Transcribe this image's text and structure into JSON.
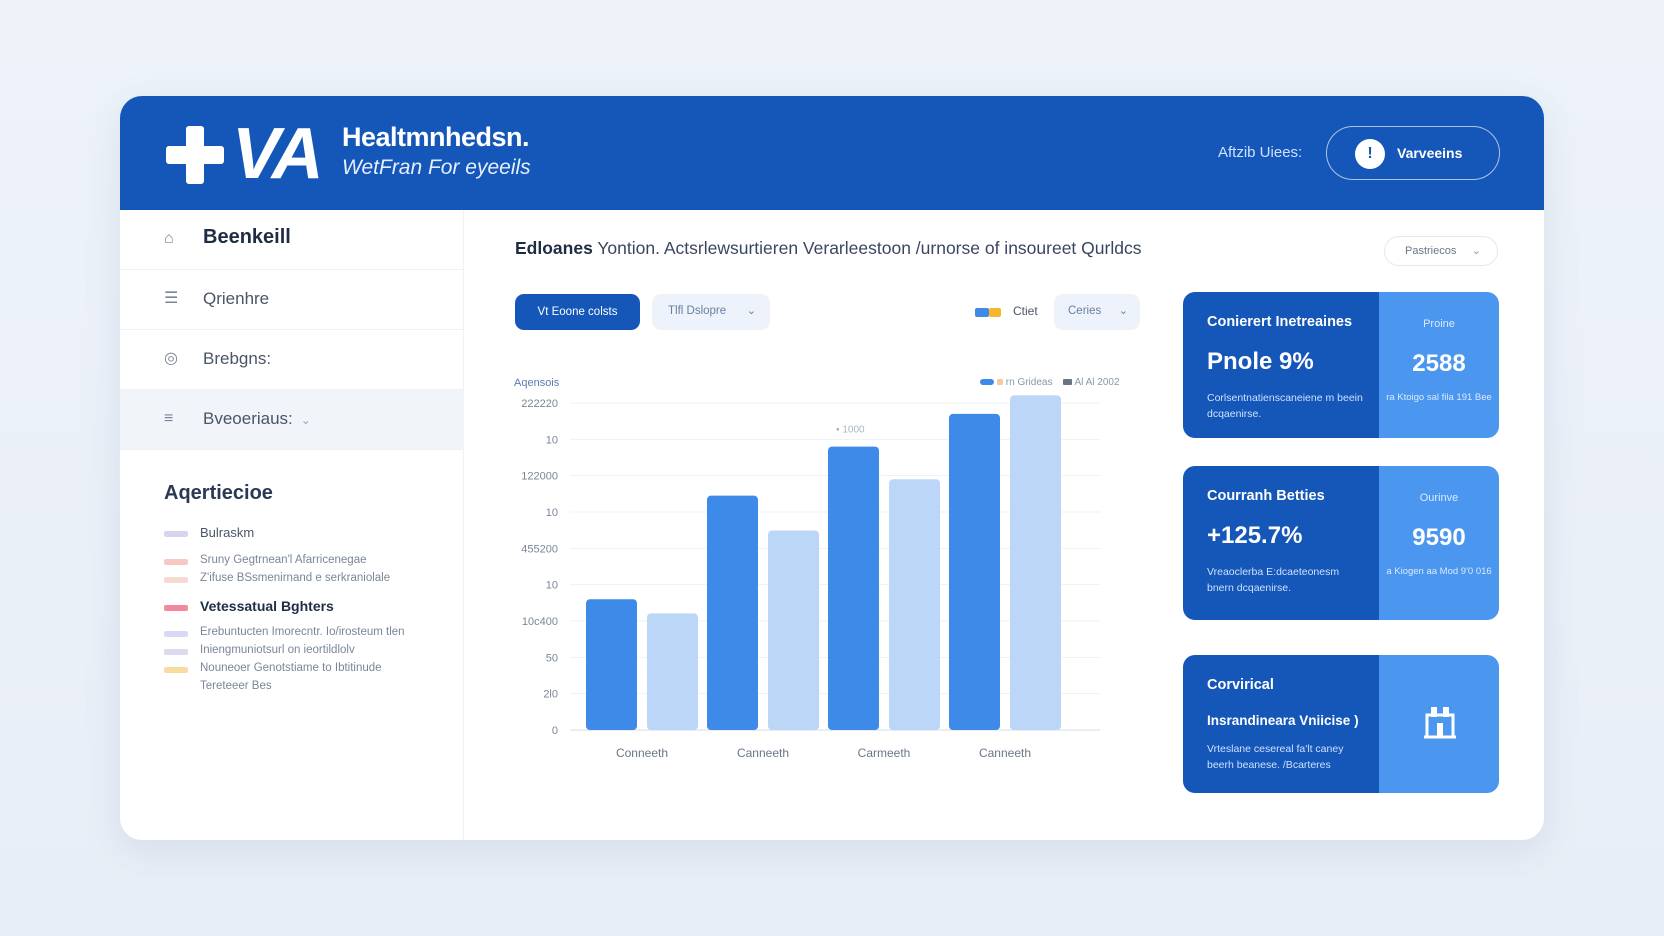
{
  "header": {
    "logo_text": "VA",
    "brand_line1": "Healtmnhedsn.",
    "brand_line2": "WetFran For eyeeils",
    "user_label": "Aftzib Uiees:",
    "user_button": "Varveeins",
    "user_icon": "user-icon"
  },
  "sidebar": {
    "items": [
      {
        "label": "Beenkeill",
        "icon": "home-icon"
      },
      {
        "label": "Qrienhre",
        "icon": "stack-icon"
      },
      {
        "label": "Brebgns:",
        "icon": "gauge-icon"
      },
      {
        "label": "Bveoeriaus:",
        "icon": "list-icon"
      }
    ],
    "section_title": "Aqertiecioe",
    "legend": [
      {
        "label": "Bulraskm",
        "color": "#d9d4ee",
        "style": "med"
      },
      {
        "label": "Sruny Gegtrnean'l Afarricenegae",
        "color": "#f6c9c2",
        "style": "small"
      },
      {
        "label": "Z'ifuse BSsmenirnand e serkraniolale",
        "color": "#f7d9d4",
        "style": "small"
      },
      {
        "label": "Vetessatual Bghters",
        "color": "#f08a9a",
        "style": "big"
      },
      {
        "label": "Erebuntucten Imorecntr. Io/irosteum tlen",
        "color": "#d6dbf3",
        "style": "small"
      },
      {
        "label": "Iniengmuniotsurl on ieortildlolv",
        "color": "#dcd9ef",
        "style": "small"
      },
      {
        "label": "Nouneoer Genotstiame to Ibtitinude",
        "color": "#f6dca0",
        "style": "small"
      },
      {
        "label": "Tereteeer Bes",
        "color": "",
        "style": "small"
      }
    ]
  },
  "main": {
    "title_bold": "Edloanes",
    "title_rest": " Yontion. Actsrlewsurtieren Verarleestoon /urnorse of insoureet Qurldcs",
    "period_button": "Pastriecos",
    "toolbar": {
      "primary_button": "Vt Eoone colsts",
      "select1": "Tlfl Dslopre",
      "legend_label": "Ctiet",
      "select2": "Ceries"
    },
    "chart_label": "Aqensois",
    "chart_legend": [
      "rn Grideas",
      "Al Al 2002"
    ]
  },
  "chart_data": {
    "type": "bar",
    "categories": [
      "Conneeth",
      "Canneeth",
      "Carmeeth",
      "Canneeth"
    ],
    "series": [
      {
        "values": [
          12,
          21.5,
          26,
          29
        ],
        "color": "#3d8ae8"
      },
      {
        "values": [
          10.7,
          18.3,
          23,
          30.7
        ],
        "color": "#bcd6f8"
      }
    ],
    "ytick_labels": [
      "0",
      "2l0",
      "50",
      "10c400",
      "10",
      "455200",
      "10",
      "122000",
      "10",
      "222220"
    ],
    "ylim": [
      0,
      30
    ],
    "annotation": "1000",
    "grid": true
  },
  "kpis": [
    {
      "title": "Conierert Inetreaines",
      "value": "Pnole 9%",
      "desc": "Corlsentnatienscaneiene m beein dcqaenirse.",
      "right_title": "Proine",
      "right_value": "2588",
      "right_desc": "ra Ktoigo sal fila 191 Bee"
    },
    {
      "title": "Courranh Betties",
      "value": "+125.7%",
      "desc": "Vreaoclerba E:dcaeteonesm bnern dcqaenirse.",
      "right_title": "Ourinve",
      "right_value": "9590",
      "right_desc": "a Kiogen aa Mod 9'0 016"
    },
    {
      "title": "Corvirical",
      "subtitle": "Insrandineara Vniicise )",
      "desc": "Vrteslane cesereal fa'lt caney beerh beanese. /Bcarteres",
      "right_icon": "building-icon"
    }
  ]
}
